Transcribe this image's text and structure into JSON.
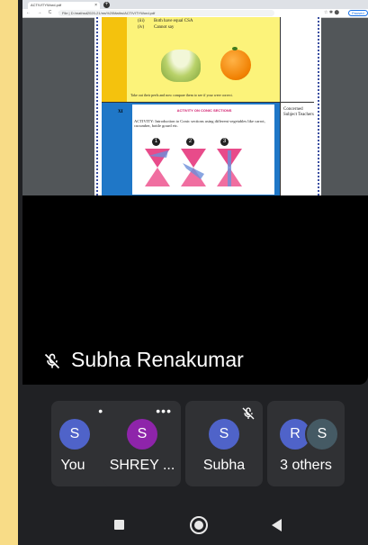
{
  "browser": {
    "tab_title": "ACTIVITYWord.pdf",
    "tab_close": "×",
    "new_tab": "+",
    "nav": "← → C ⌂",
    "url": "File | D:/mathsd2020-21/ms%20Maths/ACTIVITYWord.pdf",
    "right_icons": "☆ ✱ ⬤",
    "paused_label": "Paused"
  },
  "document": {
    "row_a": {
      "option_iii": "(iii)",
      "option_iii_text": "Both have equal CSA",
      "option_iv": "(iv)",
      "option_iv_text": "Cannot say",
      "note": "Take out their peels and now compare them to see if your were correct."
    },
    "row_b": {
      "class": "XI",
      "heading": "ACTIVITY ON CONIC SECTIONS",
      "activity": "ACTIVITY: Introduction to Conic sections using different vegetables like carrot, cucumber, bottle gourd etc.",
      "cone_numbers": [
        "1",
        "2",
        "3"
      ],
      "concerned": "Concerned Subject Teachers"
    }
  },
  "presenter": {
    "name": "Subha Renakumar"
  },
  "participants": [
    {
      "initial": "S",
      "name": "You",
      "avatar_color": "#4f63c9"
    },
    {
      "initial": "S",
      "name": "SHREY ...",
      "avatar_color": "#8e24aa"
    },
    {
      "initial": "S",
      "name": "Subha",
      "avatar_color": "#4f63c9"
    },
    {
      "initial_a": "R",
      "initial_b": "S",
      "name": "3 others",
      "avatar_color_a": "#4f63c9",
      "avatar_color_b": "#455a64"
    }
  ],
  "tile_menu": "•••",
  "colors": {
    "background": "#f8dc87",
    "meet_background": "#202124",
    "tile": "#303134"
  }
}
